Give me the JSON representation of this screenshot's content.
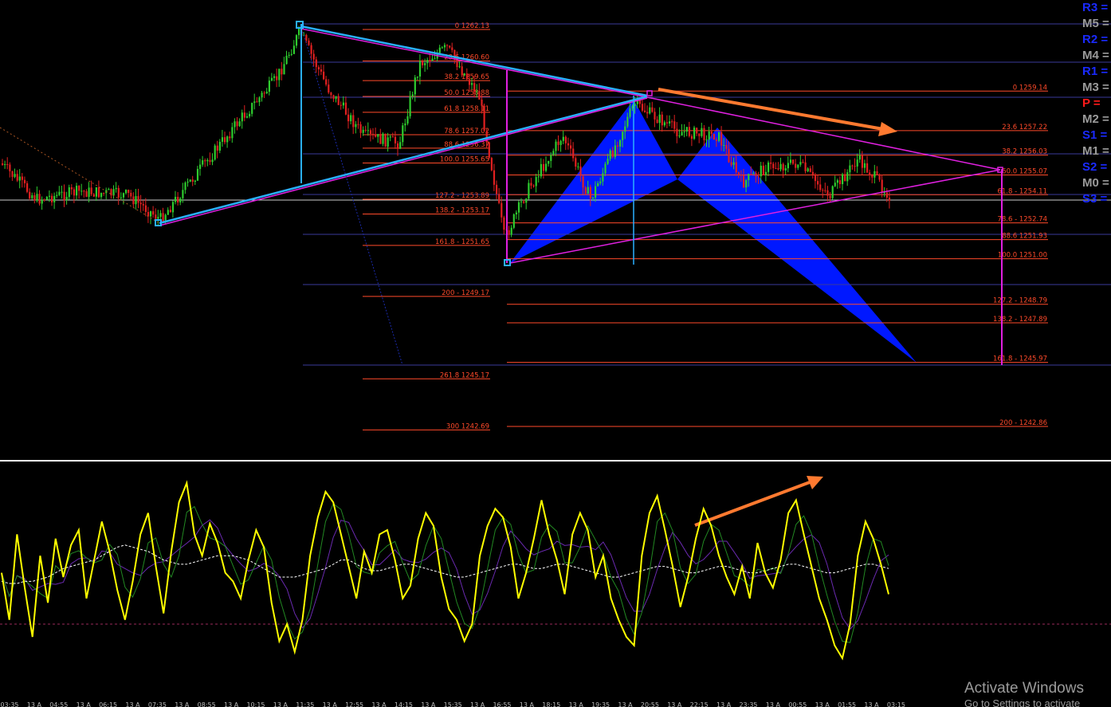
{
  "chart_data": {
    "type": "candlestick",
    "title": "",
    "colors": {
      "background": "#000000",
      "bull_candle": "#2ecc2e",
      "bear_candle": "#e02020",
      "fib_levels": "#ff4a2a",
      "pattern_fill": "#0018ff",
      "trendline_blue": "#2ab0ff",
      "trendline_magenta": "#e020e0",
      "arrow": "#ff7a30",
      "oscillator_main": "#ffff00",
      "oscillator_signal": "#228822",
      "oscillator_signal2": "#6a2ab0",
      "oscillator_avg": "#ffffff",
      "grid_line": "#3a3a9a"
    },
    "fib_set_1": [
      {
        "label": "0 1262.13",
        "price": 1262.13
      },
      {
        "label": "23.6 1260.60",
        "price": 1260.6
      },
      {
        "label": "38.2 1259.65",
        "price": 1259.65
      },
      {
        "label": "50.0 1258.88",
        "price": 1258.88
      },
      {
        "label": "61.8 1258.11",
        "price": 1258.11
      },
      {
        "label": "78.6 1257.02",
        "price": 1257.02
      },
      {
        "label": "88.6 1256.37",
        "price": 1256.37
      },
      {
        "label": "100.0 1255.65",
        "price": 1255.65
      },
      {
        "label": "127.2 - 1253.89",
        "price": 1253.89
      },
      {
        "label": "138.2 - 1253.17",
        "price": 1253.17
      },
      {
        "label": "161.8 - 1251.65",
        "price": 1251.65
      },
      {
        "label": "200 - 1249.17",
        "price": 1249.17
      },
      {
        "label": "261.8 1245.17",
        "price": 1245.17
      },
      {
        "label": "300 1242.69",
        "price": 1242.69
      }
    ],
    "fib_set_2": [
      {
        "label": "0 1259.14",
        "price": 1259.14
      },
      {
        "label": "23.6 1257.22",
        "price": 1257.22
      },
      {
        "label": "38.2 1256.03",
        "price": 1256.03
      },
      {
        "label": "50.0 1255.07",
        "price": 1255.07
      },
      {
        "label": "61.8 - 1254.11",
        "price": 1254.11
      },
      {
        "label": "78.6 - 1252.74",
        "price": 1252.74
      },
      {
        "label": "88.6 1251.93",
        "price": 1251.93
      },
      {
        "label": "100.0 1251.00",
        "price": 1251.0
      },
      {
        "label": "127.2 - 1248.79",
        "price": 1248.79
      },
      {
        "label": "138.2 - 1247.89",
        "price": 1247.89
      },
      {
        "label": "161.8 - 1245.97",
        "price": 1245.97
      },
      {
        "label": "200 - 1242.86",
        "price": 1242.86
      }
    ],
    "pivot_levels": [
      {
        "label": "R3",
        "color": "#1a2aff",
        "price": 1262.3
      },
      {
        "label": "M5",
        "color": "#9a9a9a",
        "price": 1262.1
      },
      {
        "label": "R2",
        "color": "#1a2aff",
        "price": 1261.6
      },
      {
        "label": "M4",
        "color": "#9a9a9a",
        "price": 1260.7
      },
      {
        "label": "R1",
        "color": "#1a2aff",
        "price": 1259.9
      },
      {
        "label": "M3",
        "color": "#9a9a9a",
        "price": 1259.14
      },
      {
        "label": "P",
        "color": "#ff1a1a",
        "price": 1258.2
      },
      {
        "label": "M2",
        "color": "#9a9a9a",
        "price": 1257.4
      },
      {
        "label": "S1",
        "color": "#1a2aff",
        "price": 1256.0
      },
      {
        "label": "M1",
        "color": "#9a9a9a",
        "price": 1255.4
      },
      {
        "label": "S2",
        "color": "#1a2aff",
        "price": 1254.8
      },
      {
        "label": "M0",
        "color": "#9a9a9a",
        "price": 1254.1
      },
      {
        "label": "S3",
        "color": "#1a2aff",
        "price": 1253.7
      }
    ],
    "pivot_suffix": "=",
    "x_tick_labels": [
      "03:35",
      "13 A",
      "04:55",
      "13 A",
      "06:15",
      "13 A",
      "07:35",
      "13 A",
      "08:55",
      "13 A",
      "10:15",
      "13 A",
      "11:35",
      "13 A",
      "12:55",
      "13 A",
      "14:15",
      "13 A",
      "15:35",
      "13 A",
      "16:55",
      "13 A",
      "18:15",
      "13 A",
      "19:35",
      "13 A",
      "20:55",
      "13 A",
      "22:15",
      "13 A",
      "23:35",
      "13 A",
      "00:55",
      "13 A",
      "01:55",
      "13 A",
      "03:15"
    ],
    "oscillator": {
      "values": [
        52,
        30,
        70,
        45,
        22,
        60,
        38,
        68,
        50,
        65,
        72,
        40,
        58,
        76,
        62,
        44,
        30,
        48,
        70,
        80,
        55,
        33,
        62,
        85,
        94,
        70,
        60,
        75,
        66,
        52,
        48,
        40,
        58,
        72,
        64,
        38,
        20,
        28,
        15,
        30,
        60,
        78,
        90,
        85,
        70,
        55,
        40,
        62,
        52,
        70,
        72,
        58,
        40,
        46,
        68,
        80,
        74,
        50,
        35,
        30,
        20,
        28,
        60,
        74,
        82,
        78,
        64,
        40,
        52,
        68,
        86,
        70,
        58,
        42,
        70,
        80,
        72,
        50,
        60,
        40,
        30,
        22,
        18,
        60,
        80,
        88,
        72,
        55,
        36,
        50,
        68,
        82,
        74,
        60,
        50,
        42,
        55,
        40,
        66,
        52,
        45,
        58,
        80,
        86,
        70,
        55,
        40,
        30,
        18,
        12,
        28,
        60,
        76,
        68,
        56,
        42
      ],
      "average": [
        48,
        47,
        47,
        48,
        48,
        49,
        50,
        52,
        54,
        55,
        56,
        57,
        58,
        60,
        62,
        64,
        65,
        64,
        63,
        62,
        60,
        58,
        57,
        56,
        56,
        57,
        58,
        59,
        60,
        60,
        60,
        59,
        58,
        56,
        54,
        52,
        50,
        50,
        50,
        51,
        52,
        53,
        54,
        56,
        58,
        58,
        56,
        54,
        53,
        53,
        54,
        55,
        56,
        56,
        55,
        54,
        53,
        52,
        51,
        50,
        50,
        51,
        52,
        53,
        54,
        55,
        56,
        56,
        55,
        54,
        54,
        55,
        56,
        56,
        55,
        54,
        53,
        52,
        51,
        50,
        50,
        51,
        52,
        53,
        54,
        55,
        55,
        54,
        53,
        52,
        52,
        53,
        54,
        55,
        55,
        54,
        53,
        52,
        52,
        53,
        54,
        55,
        56,
        56,
        55,
        54,
        53,
        52,
        52,
        53,
        54,
        55,
        56,
        56,
        55,
        54
      ],
      "ylim": [
        0,
        100
      ],
      "zero_level": 32
    }
  },
  "watermark": {
    "title": "Activate Windows",
    "subtitle": "Go to Settings to activate"
  }
}
